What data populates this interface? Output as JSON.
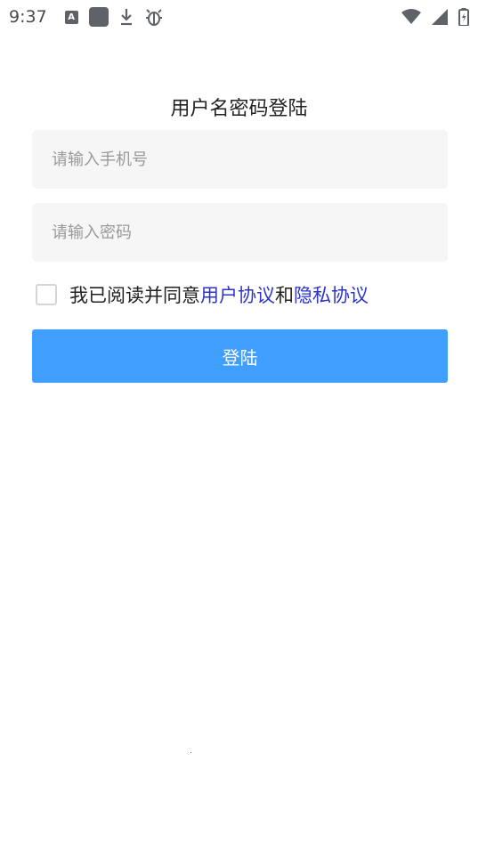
{
  "status_bar": {
    "time": "9:37",
    "icons": [
      "a-notification-icon",
      "app-square-icon",
      "download-icon",
      "bug-icon",
      "wifi-icon",
      "signal-icon",
      "battery-charging-icon"
    ]
  },
  "login": {
    "title": "用户名密码登陆",
    "phone": {
      "placeholder": "请输入手机号",
      "value": ""
    },
    "password": {
      "placeholder": "请输入密码",
      "value": ""
    },
    "agreement": {
      "checked": false,
      "prefix": "我已阅读并同意",
      "user_agreement": "用户协议",
      "conjunction": "和",
      "privacy_agreement": "隐私协议",
      "link_color": "#2c34c8"
    },
    "submit_label": "登陆",
    "button_color": "#409eff"
  }
}
